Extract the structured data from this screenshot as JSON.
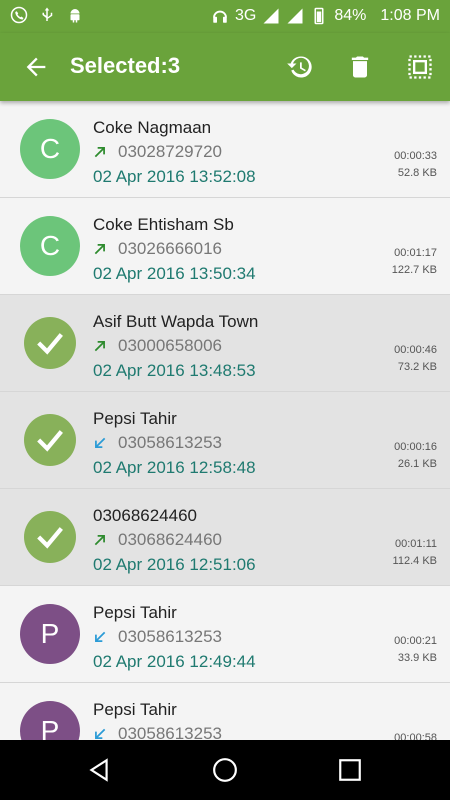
{
  "status_bar": {
    "network": "3G",
    "battery": "84%",
    "time": "1:08 PM"
  },
  "app_bar": {
    "title": "Selected:3"
  },
  "colors": {
    "green": "#6aa33b",
    "avatar_c": "#6cc57a",
    "avatar_p": "#7d4f86",
    "check": "#88b15a",
    "date": "#1f7a70",
    "outgoing": "#2e8b2e",
    "incoming": "#2b9bd6"
  },
  "calls": [
    {
      "name": "Coke Nagmaan",
      "number": "03028729720",
      "date": "02 Apr 2016 13:52:08",
      "duration": "00:00:33",
      "size": "52.8 KB",
      "direction": "outgoing",
      "initial": "C",
      "avatar_color": "#6cc57a",
      "selected": false
    },
    {
      "name": "Coke Ehtisham Sb",
      "number": "03026666016",
      "date": "02 Apr 2016 13:50:34",
      "duration": "00:01:17",
      "size": "122.7 KB",
      "direction": "outgoing",
      "initial": "C",
      "avatar_color": "#6cc57a",
      "selected": false
    },
    {
      "name": "Asif Butt Wapda Town",
      "number": "03000658006",
      "date": "02 Apr 2016 13:48:53",
      "duration": "00:00:46",
      "size": "73.2 KB",
      "direction": "outgoing",
      "initial": "",
      "avatar_color": "",
      "selected": true
    },
    {
      "name": "Pepsi Tahir",
      "number": "03058613253",
      "date": "02 Apr 2016 12:58:48",
      "duration": "00:00:16",
      "size": "26.1 KB",
      "direction": "incoming",
      "initial": "",
      "avatar_color": "",
      "selected": true
    },
    {
      "name": "03068624460",
      "number": "03068624460",
      "date": "02 Apr 2016 12:51:06",
      "duration": "00:01:11",
      "size": "112.4 KB",
      "direction": "outgoing",
      "initial": "",
      "avatar_color": "",
      "selected": true
    },
    {
      "name": "Pepsi Tahir",
      "number": "03058613253",
      "date": "02 Apr 2016 12:49:44",
      "duration": "00:00:21",
      "size": "33.9 KB",
      "direction": "incoming",
      "initial": "P",
      "avatar_color": "#7d4f86",
      "selected": false
    },
    {
      "name": "Pepsi Tahir",
      "number": "03058613253",
      "date": "",
      "duration": "00:00:58",
      "size": "",
      "direction": "incoming",
      "initial": "P",
      "avatar_color": "#7d4f86",
      "selected": false
    }
  ]
}
